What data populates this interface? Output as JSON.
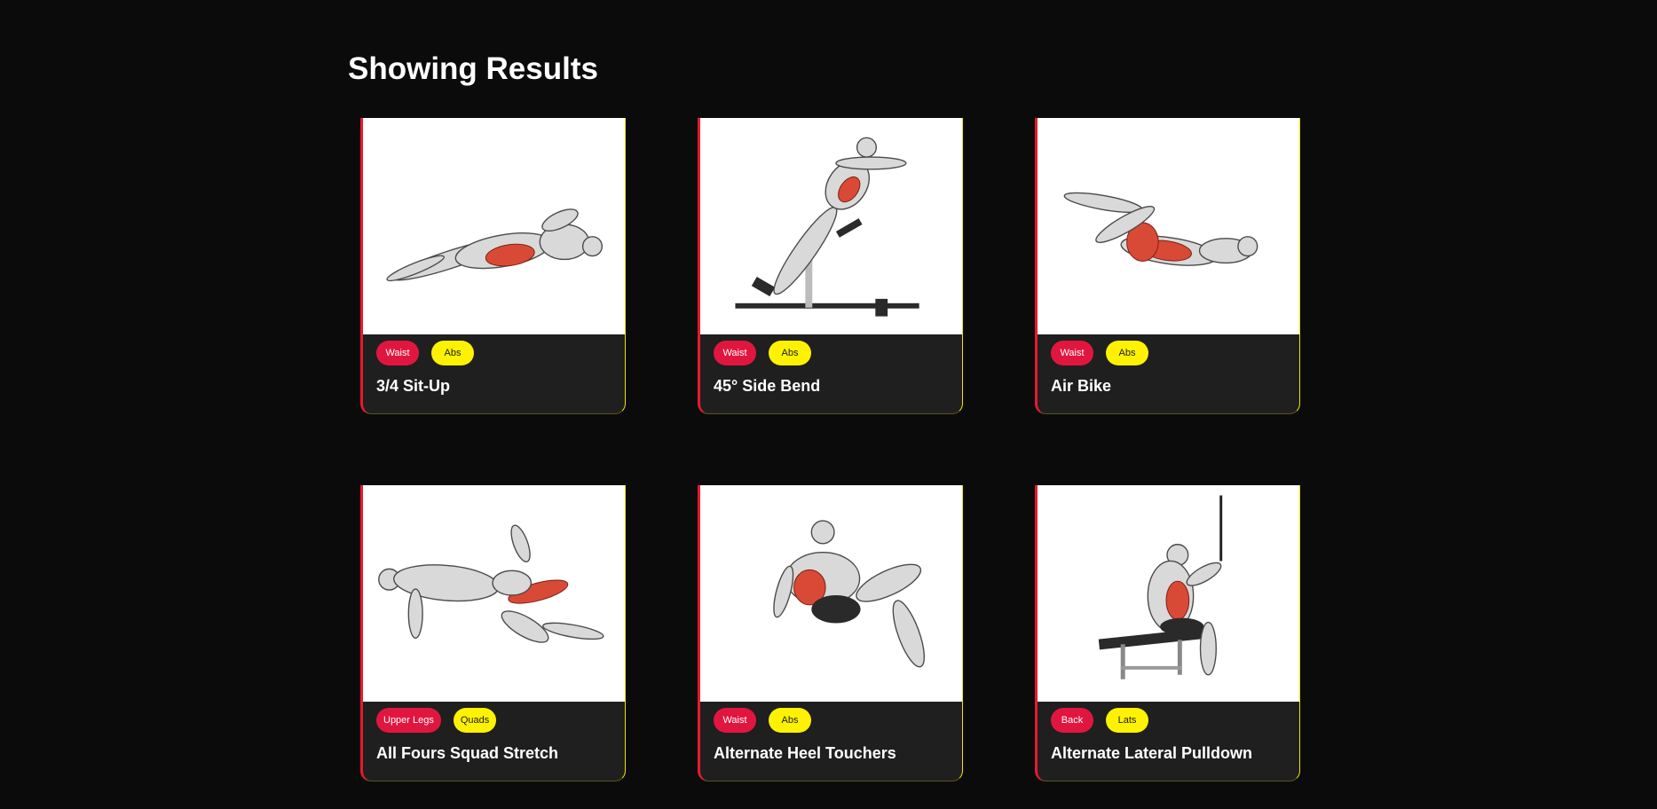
{
  "page": {
    "heading": "Showing Results"
  },
  "exercises": [
    {
      "name": "3/4 Sit-Up",
      "body_part": "Waist",
      "target": "Abs",
      "image_icon": "sit-up-figure"
    },
    {
      "name": "45° Side Bend",
      "body_part": "Waist",
      "target": "Abs",
      "image_icon": "side-bend-figure"
    },
    {
      "name": "Air Bike",
      "body_part": "Waist",
      "target": "Abs",
      "image_icon": "air-bike-figure"
    },
    {
      "name": "All Fours Squad Stretch",
      "body_part": "Upper Legs",
      "target": "Quads",
      "image_icon": "quad-stretch-figure"
    },
    {
      "name": "Alternate Heel Touchers",
      "body_part": "Waist",
      "target": "Abs",
      "image_icon": "heel-touch-figure"
    },
    {
      "name": "Alternate Lateral Pulldown",
      "body_part": "Back",
      "target": "Lats",
      "image_icon": "lat-pulldown-figure"
    }
  ],
  "colors": {
    "background": "#0b0b0b",
    "card": "#1f1f1f",
    "body_tag": "#e1163f",
    "target_tag": "#fff200",
    "accent_left": "#e7192f",
    "accent_right": "#f2e300"
  }
}
